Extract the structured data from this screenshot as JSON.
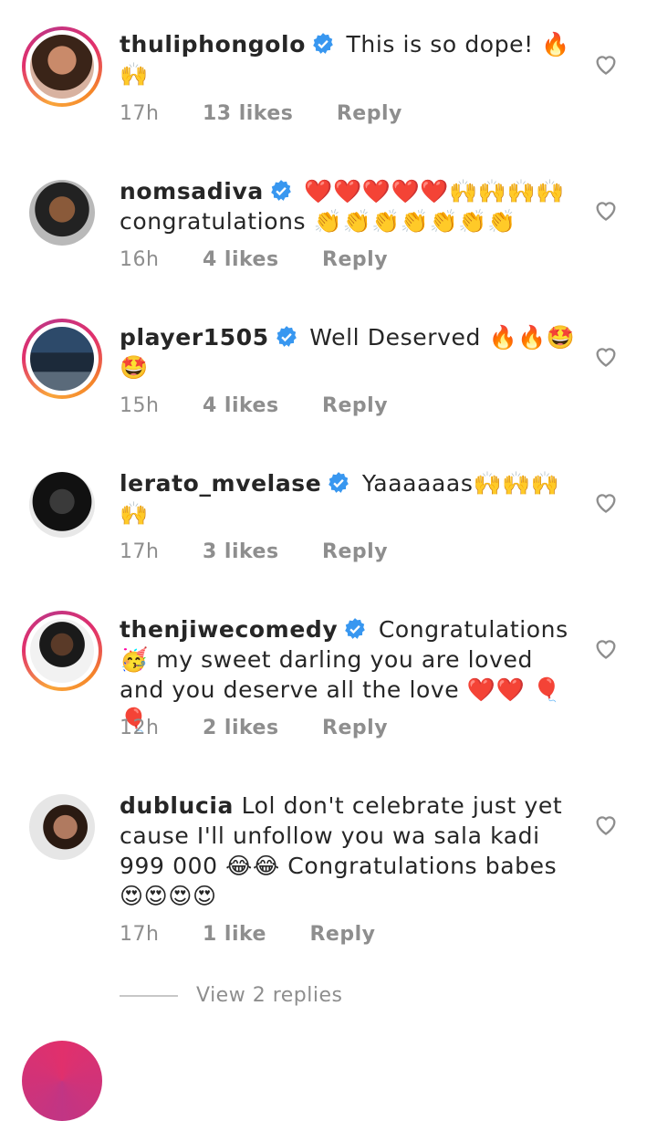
{
  "colors": {
    "verified": "#3897f0",
    "muted": "#8e8e8e",
    "text": "#262626"
  },
  "comments": [
    {
      "username": "thuliphongolo",
      "verified": true,
      "text": "This is so dope! 🔥🙌",
      "time": "17h",
      "likes": "13 likes",
      "reply": "Reply",
      "avatar_ring": true
    },
    {
      "username": "nomsadiva",
      "verified": true,
      "text": "❤️❤️❤️❤️❤️🙌🙌🙌🙌 congratulations 👏👏👏👏👏👏👏",
      "time": "16h",
      "likes": "4 likes",
      "reply": "Reply",
      "avatar_ring": false
    },
    {
      "username": "player1505",
      "verified": true,
      "text": "Well Deserved 🔥🔥🤩🤩",
      "time": "15h",
      "likes": "4 likes",
      "reply": "Reply",
      "avatar_ring": true
    },
    {
      "username": "lerato_mvelase",
      "verified": true,
      "text": "Yaaaaaas🙌🙌🙌🙌",
      "time": "17h",
      "likes": "3 likes",
      "reply": "Reply",
      "avatar_ring": false
    },
    {
      "username": "thenjiwecomedy",
      "verified": true,
      "text": "Congratulations 🥳 my sweet darling you are loved and you deserve all the love ❤️❤️ 🎈 🎈",
      "time": "12h",
      "likes": "2 likes",
      "reply": "Reply",
      "avatar_ring": true
    },
    {
      "username": "dublucia",
      "verified": false,
      "text": "Lol don't celebrate just yet cause I'll unfollow you wa sala kadi 999 000 😂😂 Congratulations babes 😍😍😍😍",
      "time": "17h",
      "likes": "1 like",
      "reply": "Reply",
      "avatar_ring": false
    }
  ],
  "view_replies": "View 2 replies"
}
